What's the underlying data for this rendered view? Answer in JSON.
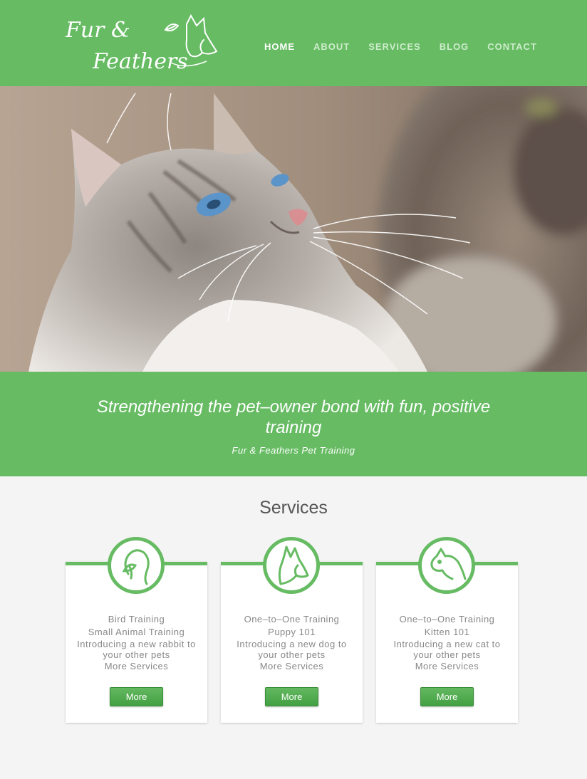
{
  "brand": {
    "logo_text_line1": "Fur &",
    "logo_text_line2": "Feathers"
  },
  "nav": [
    {
      "label": "HOME",
      "active": true
    },
    {
      "label": "ABOUT",
      "active": false
    },
    {
      "label": "SERVICES",
      "active": false
    },
    {
      "label": "BLOG",
      "active": false
    },
    {
      "label": "CONTACT",
      "active": false
    }
  ],
  "hero": {
    "image": "cat-photo"
  },
  "tagline": {
    "headline": "Strengthening the pet–owner bond with fun, positive training",
    "subtitle": "Fur & Feathers Pet Training"
  },
  "services": {
    "title": "Services",
    "cards": [
      {
        "icon": "bird-icon",
        "lines": [
          "Bird Training",
          "Small Animal Training",
          "Introducing a new rabbit to your other pets",
          "More Services"
        ],
        "button": "More"
      },
      {
        "icon": "dog-icon",
        "lines": [
          "One–to–One Training",
          "Puppy 101",
          "Introducing a new dog to your other pets",
          "More Services"
        ],
        "button": "More"
      },
      {
        "icon": "cat-icon",
        "lines": [
          "One–to–One Training",
          "Kitten 101",
          "Introducing a new cat to your other pets",
          "More Services"
        ],
        "button": "More"
      }
    ]
  },
  "colors": {
    "brand_green": "#66bb63",
    "background": "#f4f4f4",
    "nav_inactive": "#cdeccb"
  }
}
